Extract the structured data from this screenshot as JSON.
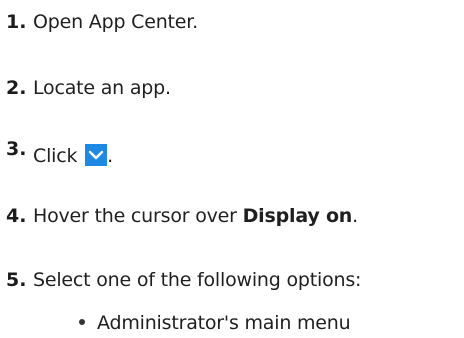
{
  "steps": [
    {
      "number": "1.",
      "text": "Open App Center."
    },
    {
      "number": "2.",
      "text": "Locate an app."
    },
    {
      "number": "3.",
      "text_before": "Click",
      "icon": "chevron-down-icon",
      "text_after": "."
    },
    {
      "number": "4.",
      "text_before": "Hover the cursor over ",
      "bold": "Display on",
      "text_after": "."
    },
    {
      "number": "5.",
      "text": "Select one of the following options:"
    }
  ],
  "options": [
    "Administrator's main menu"
  ],
  "colors": {
    "text": "#1f1f1f",
    "button_blue": "#1e88e5"
  }
}
